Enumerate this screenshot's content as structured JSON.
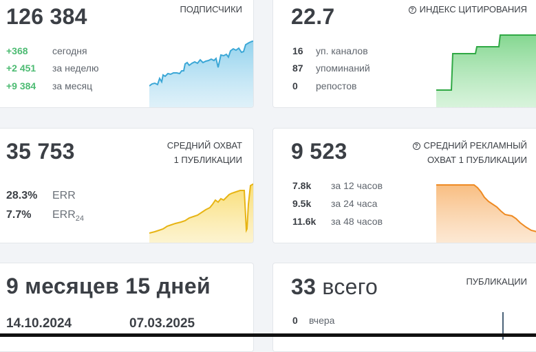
{
  "subscribers": {
    "value": "126 384",
    "title": "ПОДПИСЧИКИ",
    "rows": [
      {
        "value": "+368",
        "label": "сегодня"
      },
      {
        "value": "+2 451",
        "label": "за неделю"
      },
      {
        "value": "+9 384",
        "label": "за месяц"
      }
    ],
    "color": "#4db3dc"
  },
  "citation": {
    "value": "22.7",
    "title": "ИНДЕКС ЦИТИРОВАНИЯ",
    "info_icon": "info-icon",
    "rows": [
      {
        "value": "16",
        "label": "уп. каналов"
      },
      {
        "value": "87",
        "label": "упоминаний"
      },
      {
        "value": "0",
        "label": "репостов"
      }
    ],
    "color": "#3fb44d"
  },
  "reach": {
    "value": "35 753",
    "title_line1": "СРЕДНИЙ ОХВАТ",
    "title_line2": "1 ПУБЛИКАЦИИ",
    "err": {
      "value": "28.3%",
      "label": "ERR"
    },
    "err24": {
      "value": "7.7%",
      "label": "ERR",
      "sub": "24"
    },
    "color": "#f2c31a"
  },
  "ad_reach": {
    "value": "9 523",
    "title_line1": "СРЕДНИЙ РЕКЛАМНЫЙ",
    "title_line2": "ОХВАТ 1 ПУБЛИКАЦИИ",
    "info_icon": "info-icon",
    "rows": [
      {
        "value": "7.8k",
        "label": "за 12 часов"
      },
      {
        "value": "9.5k",
        "label": "за 24 часа"
      },
      {
        "value": "11.6k",
        "label": "за 48 часов"
      }
    ],
    "color": "#f39a3a"
  },
  "age": {
    "value": "9 месяцев 15 дней",
    "date_from": "14.10.2024",
    "date_to": "07.03.2025"
  },
  "publications": {
    "value": "33",
    "value_suffix": "всего",
    "title": "ПУБЛИКАЦИИ",
    "rows": [
      {
        "value": "0",
        "label": "вчера"
      }
    ]
  }
}
